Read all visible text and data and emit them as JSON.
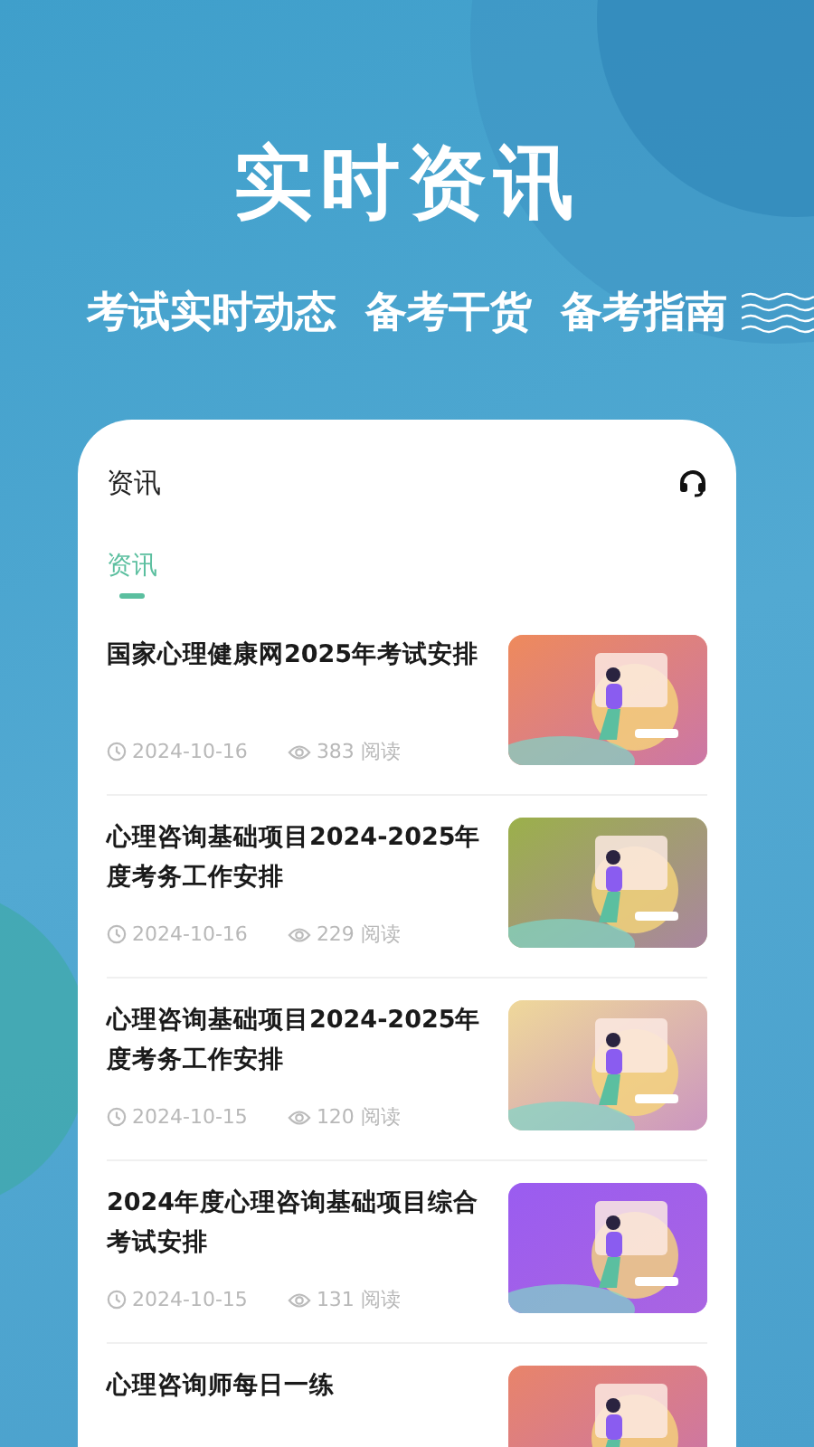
{
  "banner": {
    "title": "实时资讯",
    "subtitle": "考试实时动态  备考干货  备考指南"
  },
  "screen": {
    "title": "资讯",
    "tabs": [
      {
        "label": "资讯",
        "selected": true
      }
    ],
    "articles": [
      {
        "title": "国家心理健康网2025年考试安排",
        "date": "2024-10-16",
        "views": "383 阅读"
      },
      {
        "title": "心理咨询基础项目2024-2025年度考务工作安排",
        "date": "2024-10-16",
        "views": "229 阅读"
      },
      {
        "title": "心理咨询基础项目2024-2025年度考务工作安排",
        "date": "2024-10-15",
        "views": "120 阅读"
      },
      {
        "title": "2024年度心理咨询基础项目综合考试安排",
        "date": "2024-10-15",
        "views": "131 阅读"
      },
      {
        "title": "心理咨询师每日一练"
      }
    ]
  }
}
